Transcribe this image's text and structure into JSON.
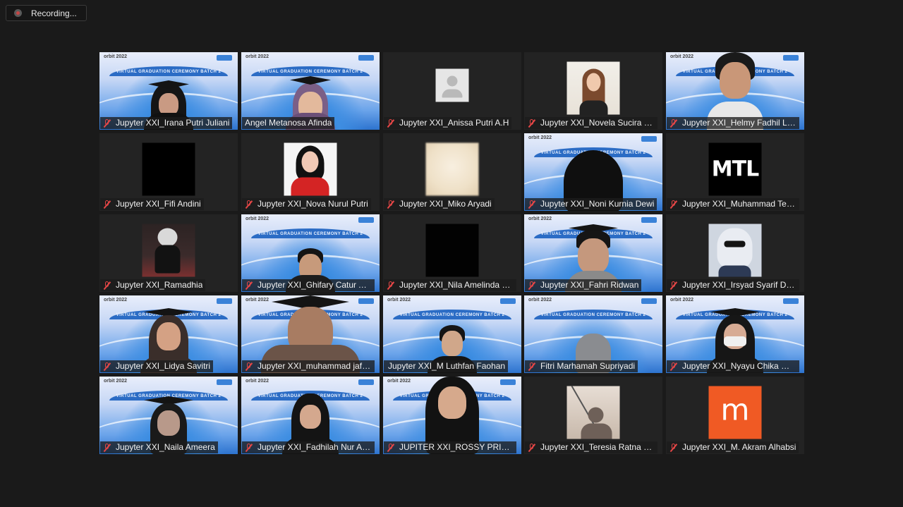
{
  "recording": {
    "label": "Recording..."
  },
  "ceremony_banner": "VIRTUAL GRADUATION CEREMONY BATCH 2",
  "colors": {
    "active_speaker": "#c5df3a",
    "muted_icon": "#e54646",
    "background": "#1a1a1a"
  },
  "participants": [
    {
      "name": "Jupyter XXI_Irana Putri Juliani",
      "muted": true
    },
    {
      "name": "Angel Metanosa Afinda",
      "muted": false
    },
    {
      "name": "Jupyter XXI_Anissa Putri A.H",
      "muted": true
    },
    {
      "name": "Jupyter XXI_Novela Sucira I. S",
      "muted": true
    },
    {
      "name": "Jupyter XXI_Helmy Fadhil Lan...",
      "muted": true
    },
    {
      "name": "Jupyter XXI_Fifi Andini",
      "muted": true
    },
    {
      "name": "Jupyter XXI_Nova Nurul Putri",
      "muted": true
    },
    {
      "name": "Jupyter XXI_Miko Aryadi",
      "muted": true
    },
    {
      "name": "Jupyter XXI_Noni Kurnia Dewi",
      "muted": true
    },
    {
      "name": "Jupyter XXI_Muhammad Tega...",
      "muted": true
    },
    {
      "name": "Jupyter XXI_Ramadhia",
      "muted": true
    },
    {
      "name": "Jupyter XXI_Ghifary Catur Ach...",
      "muted": true
    },
    {
      "name": "Jupyter XXI_Nila Amelinda Putri",
      "muted": true
    },
    {
      "name": "Jupyter XXI_Fahri Ridwan",
      "muted": true
    },
    {
      "name": "Jupyter XXI_Irsyad Syarif Dwi ...",
      "muted": true
    },
    {
      "name": "Jupyter XXI_Lidya Savitri",
      "muted": true
    },
    {
      "name": "Jupyter XXI_muhammad jafar ...",
      "muted": true
    },
    {
      "name": "Jupyter XXI_M Luthfan Faohan",
      "muted": false,
      "active": true
    },
    {
      "name": "Fitri Marhamah Supriyadi",
      "muted": true
    },
    {
      "name": "Jupyter XXI_Nyayu Chika Mar...",
      "muted": true
    },
    {
      "name": "Jupyter XXI_Naila Ameera",
      "muted": true
    },
    {
      "name": "Jupyter XXI_Fadhilah Nur Ama...",
      "muted": true
    },
    {
      "name": "JUPITER XXI_ROSSY PRIMA N...",
      "muted": true
    },
    {
      "name": "Jupyter XXI_Teresia Ratna Cali...",
      "muted": true
    },
    {
      "name": "Jupyter XXI_M. Akram Alhabsi",
      "muted": true
    }
  ],
  "avatar_text": {
    "mtl": "MTL",
    "m": "m"
  }
}
